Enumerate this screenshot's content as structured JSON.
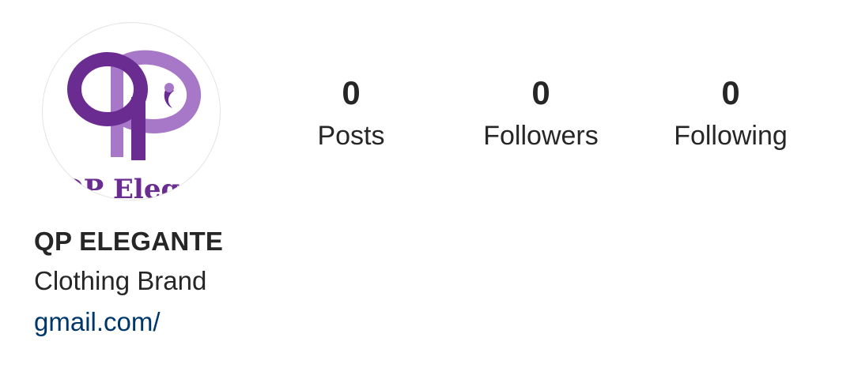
{
  "profile": {
    "avatar_logo_text": "QP Elegante",
    "avatar_icon": "brand-logo-icon",
    "brand_colors": {
      "primary_purple": "#6a2c91",
      "light_purple": "#a878c8"
    },
    "name": "QP ELEGANTE",
    "category": "Clothing Brand",
    "link": "gmail.com/"
  },
  "stats": [
    {
      "count": "0",
      "label": "Posts"
    },
    {
      "count": "0",
      "label": "Followers"
    },
    {
      "count": "0",
      "label": "Following"
    }
  ],
  "colors": {
    "text": "#262626",
    "link": "#00376b",
    "avatar_border": "#e3e3e3"
  }
}
